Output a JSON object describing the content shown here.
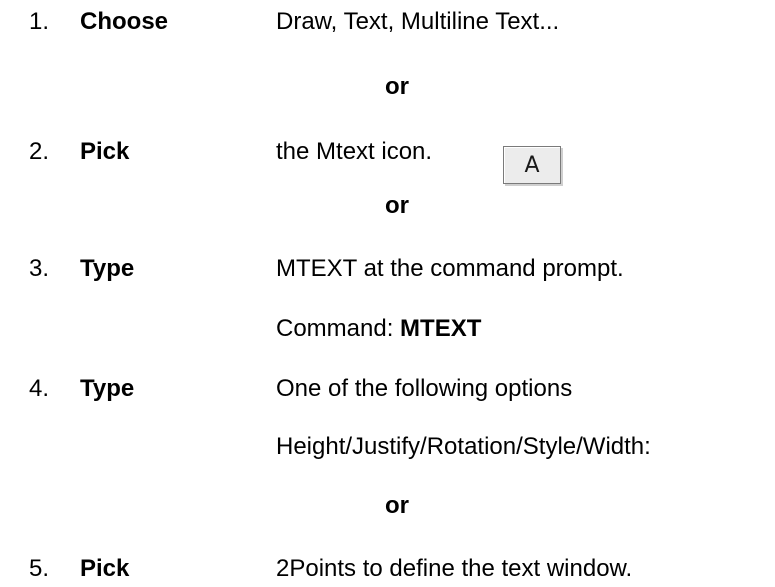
{
  "steps": [
    {
      "number": "1.",
      "verb": "Choose",
      "text": "Draw, Text, Multiline Text..."
    },
    {
      "number": "2.",
      "verb": "Pick",
      "text": "the Mtext icon."
    },
    {
      "number": "3.",
      "verb": "Type",
      "text": "MTEXT at the command prompt.",
      "sub_label": "Command: ",
      "sub_value": "MTEXT"
    },
    {
      "number": "4.",
      "verb": "Type",
      "text": "One of the following options",
      "sub_text": "Height/Justify/Rotation/Style/Width:"
    },
    {
      "number": "5.",
      "verb": "Pick",
      "text": "2Points to define the text window."
    }
  ],
  "or_label": "or",
  "mtext_icon": {
    "glyph": "A",
    "icon": "mtext-icon"
  }
}
